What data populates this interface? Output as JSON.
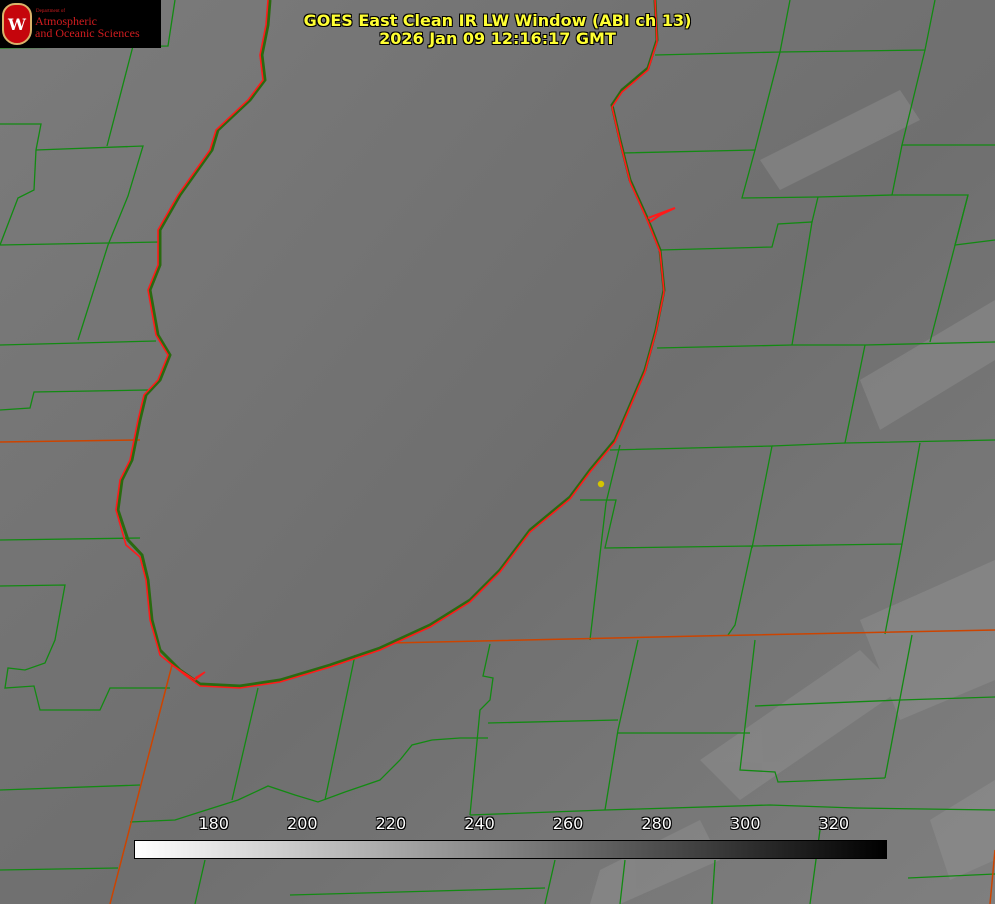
{
  "header": {
    "title": "GOES East Clean IR LW Window (ABI ch 13)",
    "timestamp": "2026 Jan 09 12:16:17 GMT"
  },
  "logo": {
    "seal_letter": "W",
    "department": "Department of",
    "line1": "Atmospheric",
    "line2": "and Oceanic Sciences"
  },
  "colorbar": {
    "ticks": [
      "180",
      "200",
      "220",
      "240",
      "260",
      "280",
      "300",
      "320"
    ],
    "range": [
      162,
      332
    ],
    "gradient": "white-to-black"
  },
  "colors": {
    "title": "#ffff33",
    "county_lines": "#128a12",
    "state_lines": "#cc4400",
    "lake_shoreline": "#ff1a1a",
    "marker": "#d4c400"
  }
}
